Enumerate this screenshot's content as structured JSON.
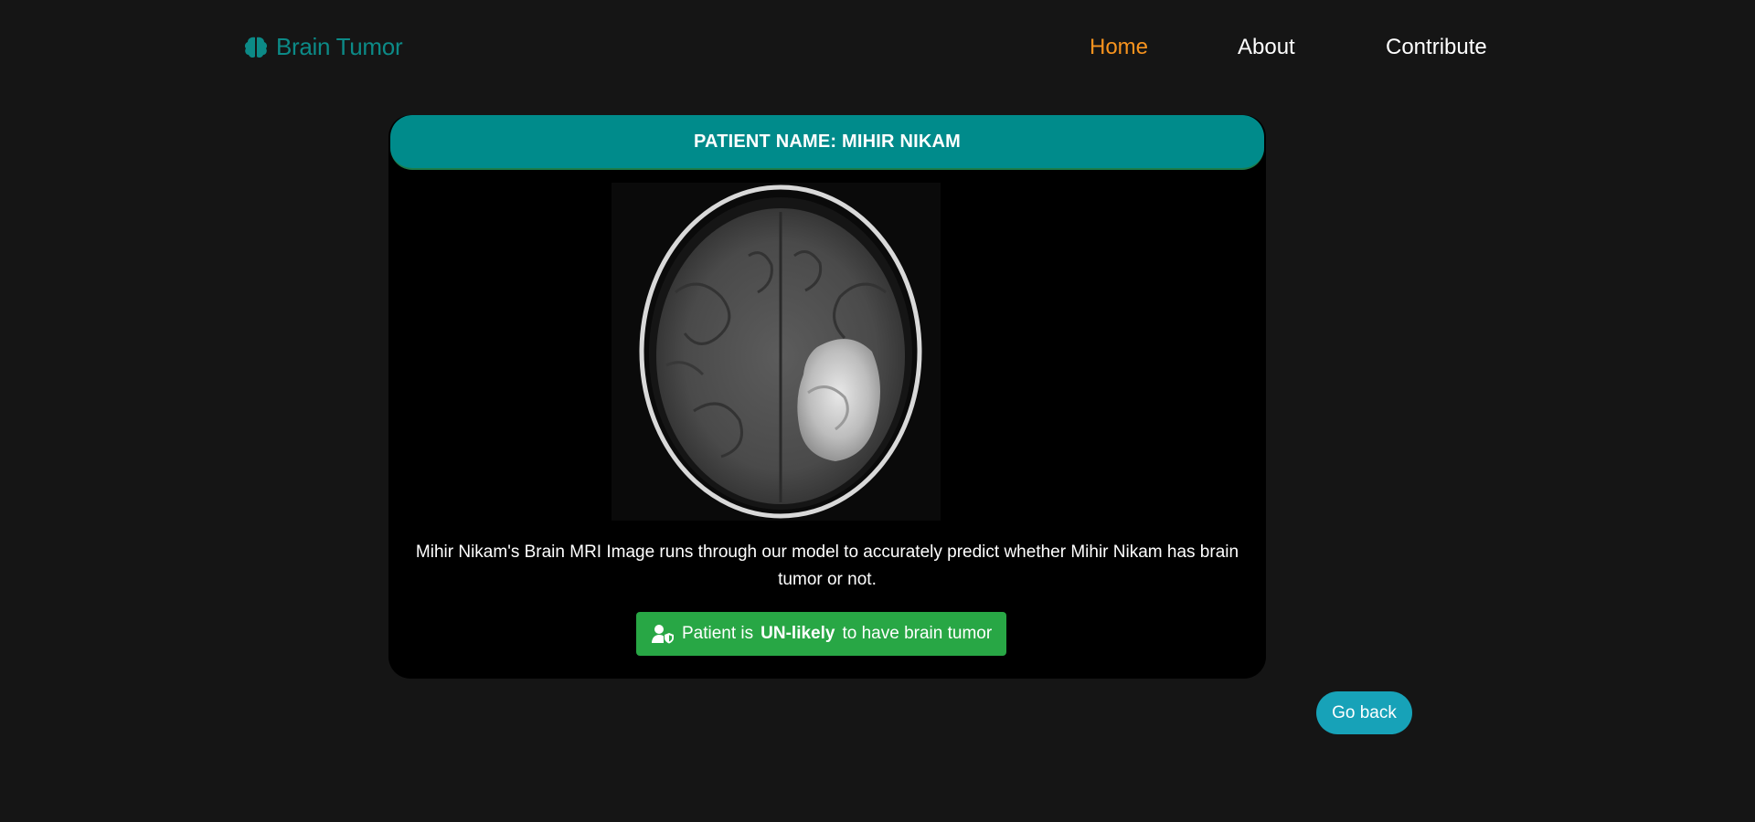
{
  "brand": {
    "name": "Brain Tumor",
    "icon": "brain-icon",
    "color": "#0c8a87"
  },
  "nav": {
    "items": [
      {
        "label": "Home",
        "active": true
      },
      {
        "label": "About",
        "active": false
      },
      {
        "label": "Contribute",
        "active": false
      }
    ],
    "active_color": "#f7931e"
  },
  "card": {
    "header": "PATIENT NAME: MIHIR NIKAM",
    "header_color": "#008b8b",
    "image": {
      "alt": "Brain MRI image",
      "icon": "mri-scan-image"
    },
    "description": "Mihir Nikam's Brain MRI Image runs through our model to accurately predict whether Mihir Nikam has brain tumor or not.",
    "result": {
      "prefix": "Patient is",
      "emphasis": "UN-likely",
      "suffix": "to have brain tumor",
      "icon": "user-shield-icon",
      "color": "#28a745"
    }
  },
  "go_back": {
    "label": "Go back",
    "color": "#17a2b8"
  }
}
